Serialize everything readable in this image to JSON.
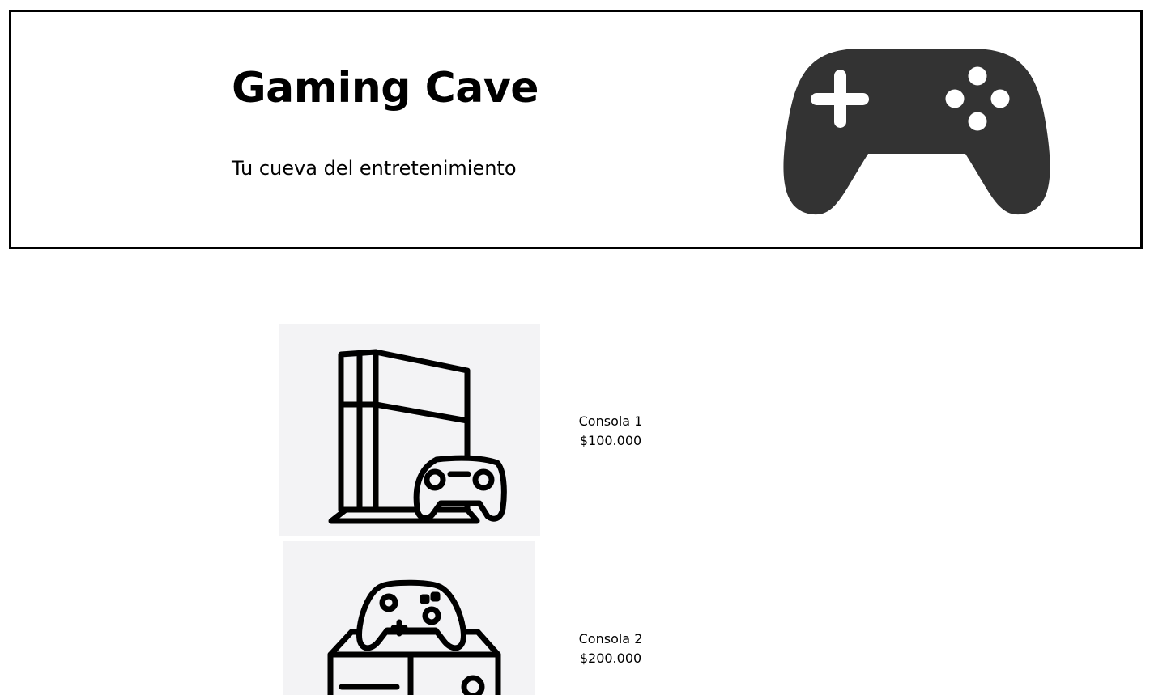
{
  "header": {
    "title": "Gaming Cave",
    "tagline": "Tu cueva del entretenimiento",
    "logo_icon": "gamepad-icon",
    "icon_color": "#333333"
  },
  "products": [
    {
      "name": "Consola 1",
      "price": "$100.000",
      "icon": "console-tower-with-controller-icon",
      "image_bg": "#f3f3f5"
    },
    {
      "name": "Consola 2",
      "price": "$200.000",
      "icon": "console-box-with-controller-icon",
      "image_bg": "#f3f3f5"
    }
  ]
}
